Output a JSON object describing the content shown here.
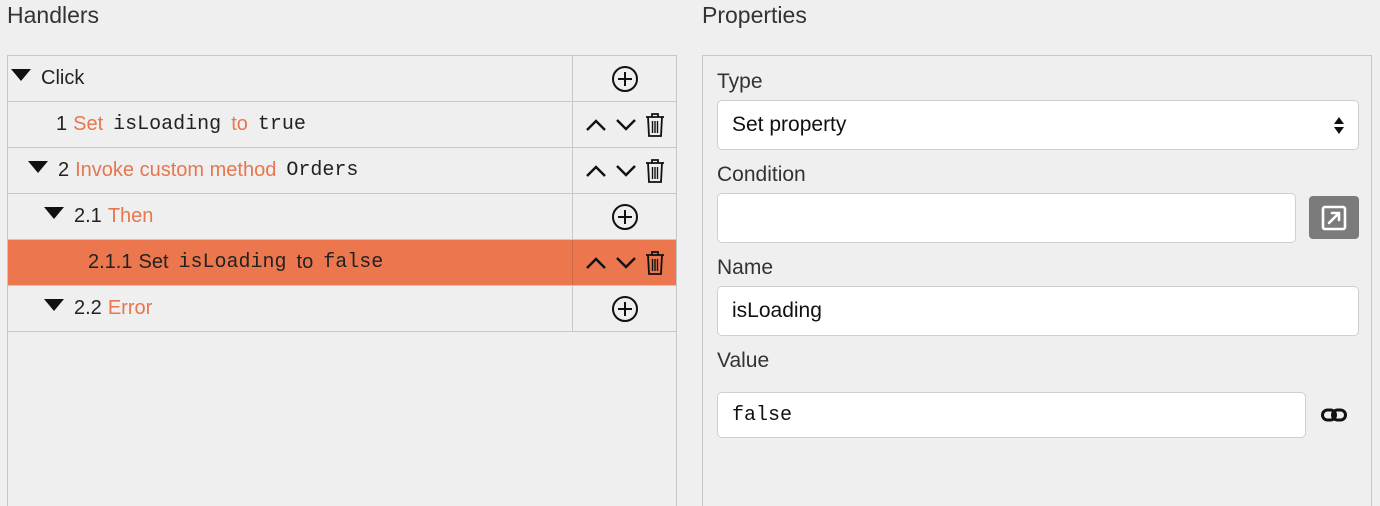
{
  "handlers_panel": {
    "title": "Handlers",
    "rows": [
      {
        "caret": true,
        "number": "",
        "parts": [
          {
            "text": "Click",
            "style": "plain"
          }
        ],
        "actions": "add"
      },
      {
        "caret": false,
        "number": "1",
        "parts": [
          {
            "text": "Set",
            "style": "orange"
          },
          {
            "text": "isLoading",
            "style": "mono"
          },
          {
            "text": "to",
            "style": "orange"
          },
          {
            "text": "true",
            "style": "mono"
          }
        ],
        "actions": "move"
      },
      {
        "caret": true,
        "number": "2",
        "parts": [
          {
            "text": "Invoke custom method",
            "style": "orange"
          },
          {
            "text": "Orders",
            "style": "mono"
          }
        ],
        "actions": "move"
      },
      {
        "caret": true,
        "number": "2.1",
        "parts": [
          {
            "text": "Then",
            "style": "orange"
          }
        ],
        "actions": "add"
      },
      {
        "caret": false,
        "number": "2.1.1",
        "parts": [
          {
            "text": "Set",
            "style": "orange"
          },
          {
            "text": "isLoading",
            "style": "mono"
          },
          {
            "text": "to",
            "style": "orange"
          },
          {
            "text": "false",
            "style": "mono"
          }
        ],
        "actions": "move",
        "selected": true
      },
      {
        "caret": true,
        "number": "2.2",
        "parts": [
          {
            "text": "Error",
            "style": "orange"
          }
        ],
        "actions": "add"
      }
    ]
  },
  "properties_panel": {
    "title": "Properties",
    "type": {
      "label": "Type",
      "value": "Set property"
    },
    "condition": {
      "label": "Condition",
      "value": ""
    },
    "name": {
      "label": "Name",
      "value": "isLoading"
    },
    "value": {
      "label": "Value",
      "value": "false"
    }
  },
  "icons": {
    "expand": "caret-down-icon",
    "add": "add-circle-icon",
    "move_up": "chevron-up-icon",
    "move_down": "chevron-down-icon",
    "delete": "trash-icon",
    "edit": "external-edit-icon",
    "link": "link-icon"
  },
  "colors": {
    "accent": "#ec774e",
    "orange_text": "#e8764e",
    "selected_row": "#ec774e"
  }
}
